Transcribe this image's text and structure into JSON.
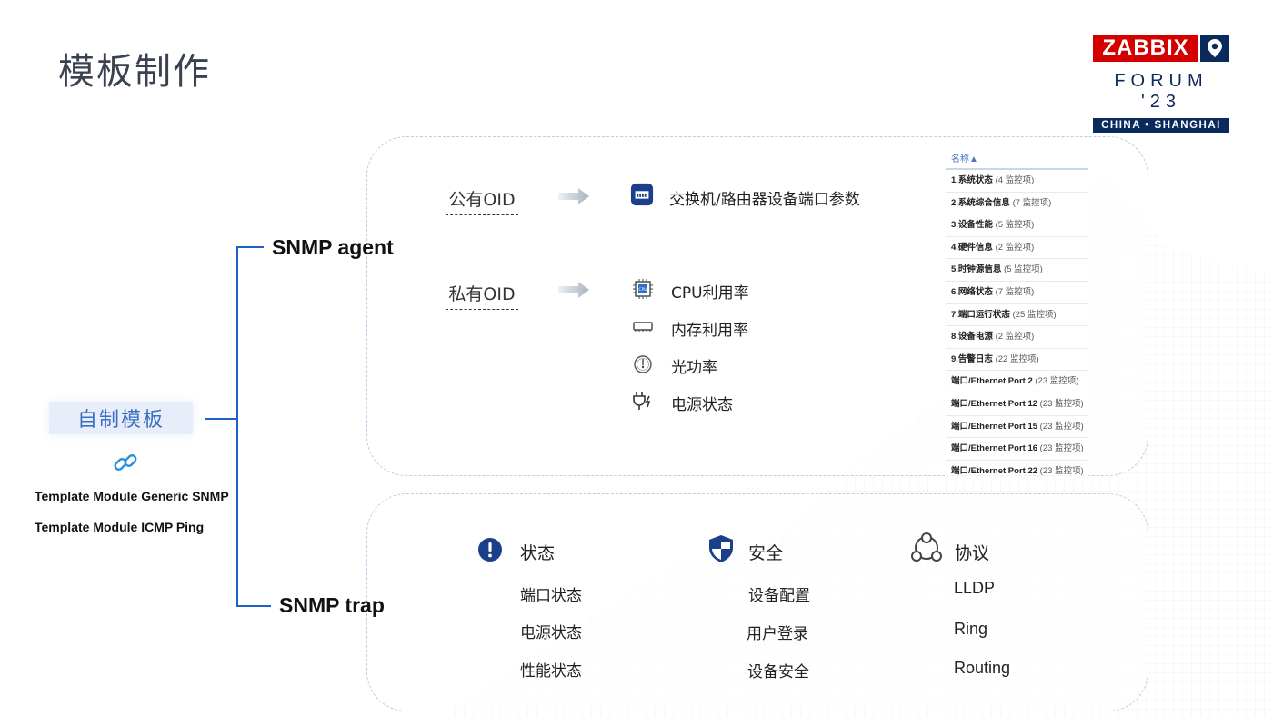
{
  "slide": {
    "title": "模板制作"
  },
  "logo": {
    "brand": "ZABBIX",
    "event": "FORUM '23",
    "location": "CHINA • SHANGHAI"
  },
  "left": {
    "root_label": "自制模板",
    "templates": [
      "Template Module Generic SNMP",
      "Template Module ICMP Ping"
    ],
    "branches": {
      "agent": "SNMP agent",
      "trap": "SNMP trap"
    }
  },
  "agent": {
    "public_oid": {
      "label": "公有OID",
      "items": [
        {
          "icon": "ethernet-port-icon",
          "text": "交换机/路由器设备端口参数"
        }
      ]
    },
    "private_oid": {
      "label": "私有OID",
      "items": [
        {
          "icon": "cpu-icon",
          "text": "CPU利用率"
        },
        {
          "icon": "memory-icon",
          "text": "内存利用率"
        },
        {
          "icon": "optical-power-icon",
          "text": "光功率"
        },
        {
          "icon": "power-plug-icon",
          "text": "电源状态"
        }
      ]
    },
    "table": {
      "header": "名称▲",
      "rows": [
        {
          "name": "1.系统状态",
          "count": "(4 监控项)"
        },
        {
          "name": "2.系统综合信息",
          "count": "(7 监控项)"
        },
        {
          "name": "3.设备性能",
          "count": "(5 监控项)"
        },
        {
          "name": "4.硬件信息",
          "count": "(2 监控项)"
        },
        {
          "name": "5.时钟源信息",
          "count": "(5 监控项)"
        },
        {
          "name": "6.网络状态",
          "count": "(7 监控项)"
        },
        {
          "name": "7.端口运行状态",
          "count": "(25 监控项)"
        },
        {
          "name": "8.设备电源",
          "count": "(2 监控项)"
        },
        {
          "name": "9.告警日志",
          "count": "(22 监控项)"
        },
        {
          "name": "端口/Ethernet Port 2",
          "count": "(23 监控项)"
        },
        {
          "name": "端口/Ethernet Port 12",
          "count": "(23 监控项)"
        },
        {
          "name": "端口/Ethernet Port 15",
          "count": "(23 监控项)"
        },
        {
          "name": "端口/Ethernet Port 16",
          "count": "(23 监控项)"
        },
        {
          "name": "端口/Ethernet Port 22",
          "count": "(23 监控项)"
        }
      ]
    }
  },
  "trap": {
    "status": {
      "title": "状态",
      "items": [
        "端口状态",
        "电源状态",
        "性能状态"
      ]
    },
    "security": {
      "title": "安全",
      "items": [
        "设备配置",
        "用户登录",
        "设备安全"
      ]
    },
    "protocol": {
      "title": "协议",
      "items": [
        "LLDP",
        "Ring",
        "Routing"
      ]
    }
  },
  "colors": {
    "accent": "#1e62c8",
    "brand_red": "#d40000",
    "brand_navy": "#0a2a5e",
    "panel_border": "#b8d0e6"
  }
}
